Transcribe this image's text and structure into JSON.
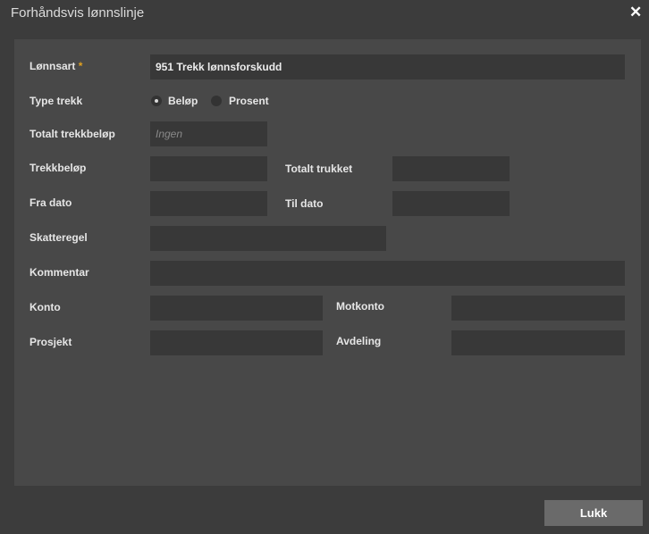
{
  "dialog": {
    "title": "Forhåndsvis lønnslinje",
    "close_glyph": "✕",
    "close_icon": "close-icon"
  },
  "form": {
    "lonnsart": {
      "label": "Lønnsart",
      "required_mark": "*",
      "value": "951 Trekk lønnsforskudd"
    },
    "type_trekk": {
      "label": "Type trekk",
      "options": [
        {
          "label": "Beløp",
          "checked": true
        },
        {
          "label": "Prosent",
          "checked": false
        }
      ]
    },
    "totalt_trekkbelop": {
      "label": "Totalt trekkbeløp",
      "placeholder": "Ingen"
    },
    "trekkbelop": {
      "label": "Trekkbeløp",
      "value": ""
    },
    "totalt_trukket": {
      "label": "Totalt trukket",
      "value": ""
    },
    "fra_dato": {
      "label": "Fra dato",
      "value": ""
    },
    "til_dato": {
      "label": "Til dato",
      "value": ""
    },
    "skatteregel": {
      "label": "Skatteregel",
      "value": ""
    },
    "kommentar": {
      "label": "Kommentar",
      "value": ""
    },
    "konto": {
      "label": "Konto",
      "value": ""
    },
    "motkonto": {
      "label": "Motkonto",
      "value": ""
    },
    "prosjekt": {
      "label": "Prosjekt",
      "value": ""
    },
    "avdeling": {
      "label": "Avdeling",
      "value": ""
    }
  },
  "footer": {
    "close_label": "Lukk"
  }
}
